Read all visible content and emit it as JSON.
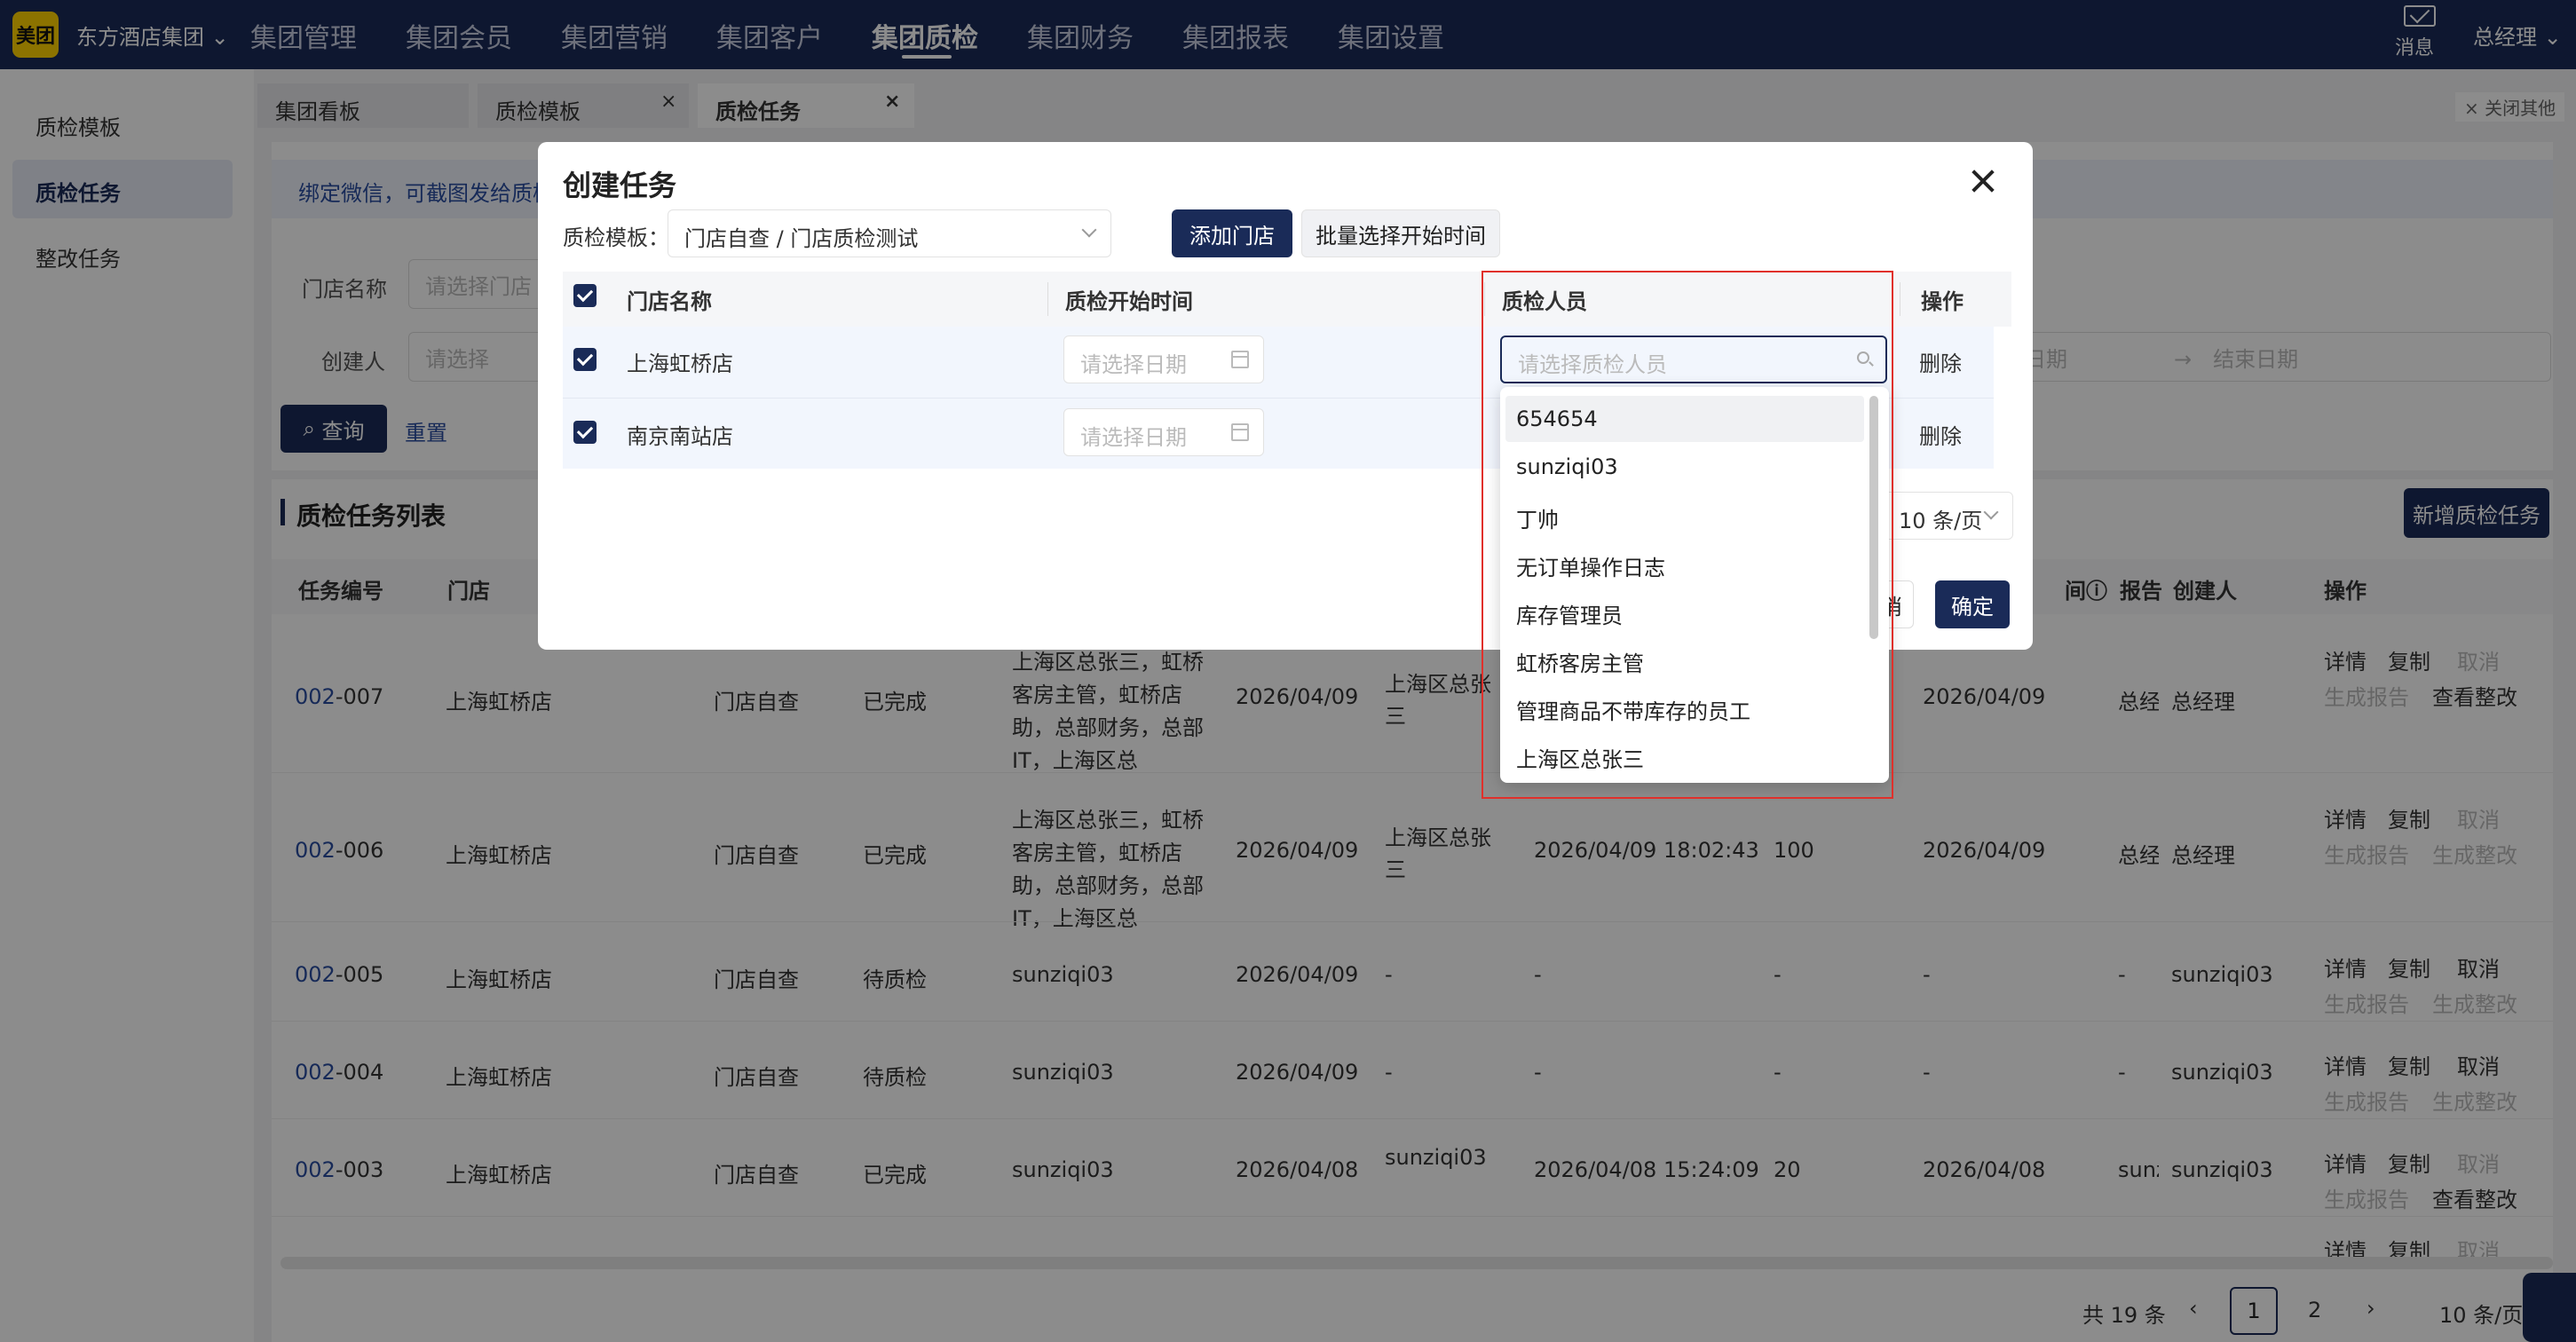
{
  "topbar": {
    "logo": "美团",
    "org": "东方酒店集团",
    "nav": [
      "集团管理",
      "集团会员",
      "集团营销",
      "集团客户",
      "集团质检",
      "集团财务",
      "集团报表",
      "集团设置"
    ],
    "active_nav": "集团质检",
    "messages": "消息",
    "user": "总经理"
  },
  "sidebar": {
    "items": [
      "质检模板",
      "质检任务",
      "整改任务"
    ],
    "selected": "质检任务"
  },
  "tabs": {
    "items": [
      "集团看板",
      "质检模板",
      "质检任务"
    ],
    "active": "质检任务",
    "close_others": "关闭其他"
  },
  "page": {
    "wechat_notice": "绑定微信，可截图发给质检",
    "filters": {
      "store_label": "门店名称",
      "store_placeholder": "请选择门店",
      "creator_label": "创建人",
      "creator_placeholder": "请选择",
      "date_start": "日期",
      "date_end": "结束日期",
      "query": "查询",
      "reset": "重置"
    },
    "list_title": "质检任务列表",
    "new_task": "新增质检任务",
    "page_size_select": "10 条/页",
    "columns": [
      "任务编号",
      "门店",
      "",
      "",
      "",
      "",
      "",
      "",
      "",
      "间",
      "报告",
      "创建人",
      "操作"
    ],
    "rows": [
      {
        "id_prefix": "002",
        "id_suffix": "-007",
        "store": "上海虹桥店",
        "type": "门店自查",
        "status": "已完成",
        "inspectors": [
          "上海区总张三，虹桥",
          "客房主管，虹桥店",
          "助，总部财务，总部",
          "IT，上海区总"
        ],
        "start": "2026/04/09",
        "exec": "上海区总张三",
        "finish": "",
        "score": "",
        "date": "2026/04/09",
        "report": "总经",
        "creator": "总经理",
        "actions": [
          "详情",
          "复制",
          "取消",
          "生成报告",
          "查看整改"
        ]
      },
      {
        "id_prefix": "002",
        "id_suffix": "-006",
        "store": "上海虹桥店",
        "type": "门店自查",
        "status": "已完成",
        "inspectors": [
          "上海区总张三，虹桥",
          "客房主管，虹桥店",
          "助，总部财务，总部",
          "IT，上海区总"
        ],
        "start": "2026/04/09",
        "exec": "上海区总张三",
        "finish": "2026/04/09 18:02:43",
        "score": "100",
        "date": "2026/04/09",
        "report": "总经",
        "creator": "总经理",
        "actions": [
          "详情",
          "复制",
          "取消",
          "生成报告",
          "生成整改"
        ]
      },
      {
        "id_prefix": "002",
        "id_suffix": "-005",
        "store": "上海虹桥店",
        "type": "门店自查",
        "status": "待质检",
        "inspectors": [
          "sunziqi03"
        ],
        "start": "2026/04/09",
        "exec": "-",
        "finish": "-",
        "score": "-",
        "date": "-",
        "report": "-",
        "creator": "sunziqi03",
        "actions": [
          "详情",
          "复制",
          "取消",
          "生成报告",
          "生成整改"
        ]
      },
      {
        "id_prefix": "002",
        "id_suffix": "-004",
        "store": "上海虹桥店",
        "type": "门店自查",
        "status": "待质检",
        "inspectors": [
          "sunziqi03"
        ],
        "start": "2026/04/09",
        "exec": "-",
        "finish": "-",
        "score": "-",
        "date": "-",
        "report": "-",
        "creator": "sunziqi03",
        "actions": [
          "详情",
          "复制",
          "取消",
          "生成报告",
          "生成整改"
        ]
      },
      {
        "id_prefix": "002",
        "id_suffix": "-003",
        "store": "上海虹桥店",
        "type": "门店自查",
        "status": "已完成",
        "inspectors": [
          "sunziqi03"
        ],
        "start": "2026/04/08",
        "exec": "sunziqi03",
        "finish": "2026/04/08 15:24:09",
        "score": "20",
        "date": "2026/04/08",
        "report": "sunz",
        "creator": "sunziqi03",
        "actions": [
          "详情",
          "复制",
          "取消",
          "生成报告",
          "查看整改"
        ]
      }
    ],
    "last_row_actions": [
      "详情",
      "复制",
      "取消"
    ],
    "pagination": {
      "total": "共 19 条",
      "pages": [
        "1",
        "2"
      ],
      "current": "1",
      "page_size": "10 条/页"
    },
    "watermark": "总经理"
  },
  "modal": {
    "title": "创建任务",
    "template_label": "质检模板：",
    "template_value": "门店自查 / 门店质检测试",
    "add_store": "添加门店",
    "batch_time": "批量选择开始时间",
    "columns": [
      "门店名称",
      "质检开始时间",
      "质检人员",
      "操作"
    ],
    "rows": [
      {
        "store": "上海虹桥店",
        "date_placeholder": "请选择日期",
        "action": "删除"
      },
      {
        "store": "南京南站店",
        "date_placeholder": "请选择日期",
        "action": "删除"
      }
    ],
    "inspector_placeholder": "请选择质检人员",
    "page_size": "10 条/页",
    "cancel": "消",
    "confirm": "确定",
    "dropdown_options": [
      "654654",
      "sunziqi03",
      "丁帅",
      "无订单操作日志",
      "库存管理员",
      "虹桥客房主管",
      "管理商品不带库存的员工",
      "上海区总张三"
    ]
  }
}
